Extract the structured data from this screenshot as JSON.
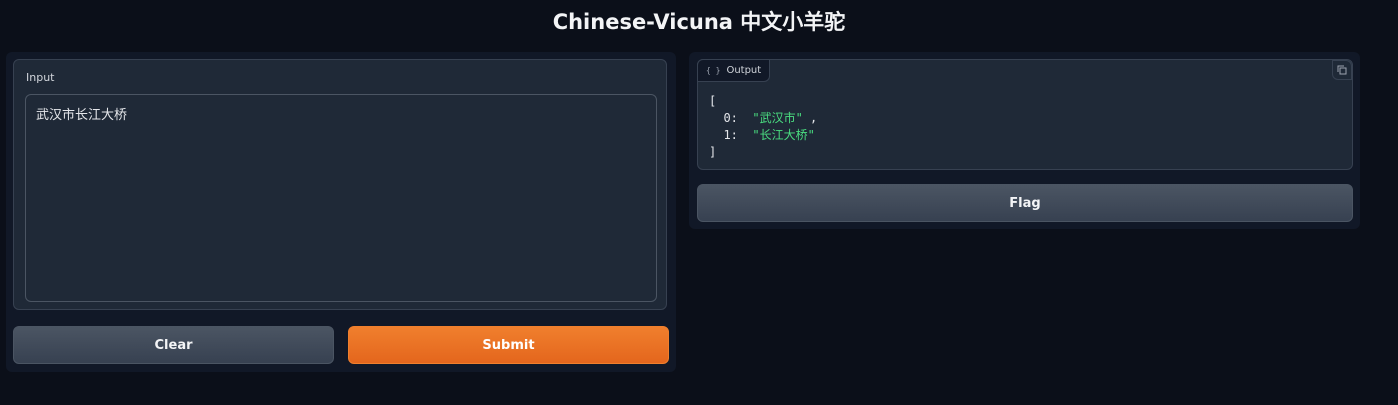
{
  "header": {
    "title": "Chinese-Vicuna 中文小羊驼"
  },
  "input": {
    "label": "Input",
    "value": "武汉市长江大桥"
  },
  "buttons": {
    "clear": "Clear",
    "submit": "Submit",
    "flag": "Flag"
  },
  "output": {
    "tab_label": "Output",
    "tab_icon": "braces-icon",
    "open_bracket": "[",
    "close_bracket": "]",
    "items": [
      {
        "index": "0:",
        "value": "\"武汉市\"",
        "sep": " ,"
      },
      {
        "index": "1:",
        "value": "\"长江大桥\"",
        "sep": ""
      }
    ]
  },
  "colors": {
    "background": "#0b0f19",
    "panel": "#111827",
    "block": "#1f2937",
    "accent": "#f07f2d",
    "json_string": "#4ade80"
  }
}
